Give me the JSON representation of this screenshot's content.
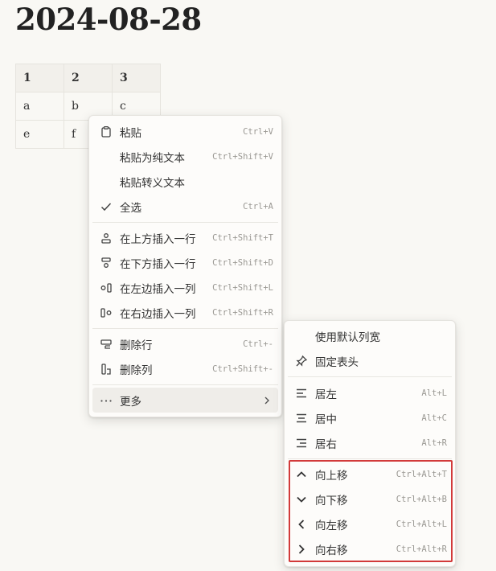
{
  "doc": {
    "title": "2024-08-28",
    "table": {
      "header": [
        "1",
        "2",
        "3"
      ],
      "rows": [
        [
          "a",
          "b",
          "c"
        ],
        [
          "e",
          "f",
          ""
        ]
      ]
    }
  },
  "context_menu": {
    "items": [
      {
        "label": "粘贴",
        "shortcut": "Ctrl+V",
        "icon": "clipboard-icon"
      },
      {
        "label": "粘贴为纯文本",
        "shortcut": "Ctrl+Shift+V"
      },
      {
        "label": "粘贴转义文本",
        "shortcut": ""
      },
      {
        "label": "全选",
        "shortcut": "Ctrl+A",
        "icon": "check-icon"
      },
      {
        "label": "在上方插入一行",
        "shortcut": "Ctrl+Shift+T",
        "icon": "insert-row-above-icon"
      },
      {
        "label": "在下方插入一行",
        "shortcut": "Ctrl+Shift+D",
        "icon": "insert-row-below-icon"
      },
      {
        "label": "在左边插入一列",
        "shortcut": "Ctrl+Shift+L",
        "icon": "insert-column-left-icon"
      },
      {
        "label": "在右边插入一列",
        "shortcut": "Ctrl+Shift+R",
        "icon": "insert-column-right-icon"
      },
      {
        "label": "删除行",
        "shortcut": "Ctrl+-",
        "icon": "delete-row-icon"
      },
      {
        "label": "删除列",
        "shortcut": "Ctrl+Shift+-",
        "icon": "delete-column-icon"
      },
      {
        "label": "更多",
        "shortcut": "",
        "icon": "more-dots-icon"
      }
    ]
  },
  "submenu": {
    "items": [
      {
        "label": "使用默认列宽",
        "shortcut": ""
      },
      {
        "label": "固定表头",
        "shortcut": "",
        "icon": "pin-icon"
      },
      {
        "label": "居左",
        "shortcut": "Alt+L",
        "icon": "align-left-icon"
      },
      {
        "label": "居中",
        "shortcut": "Alt+C",
        "icon": "align-center-icon"
      },
      {
        "label": "居右",
        "shortcut": "Alt+R",
        "icon": "align-right-icon"
      },
      {
        "label": "向上移",
        "shortcut": "Ctrl+Alt+T",
        "icon": "chevron-up-icon"
      },
      {
        "label": "向下移",
        "shortcut": "Ctrl+Alt+B",
        "icon": "chevron-down-icon"
      },
      {
        "label": "向左移",
        "shortcut": "Ctrl+Alt+L",
        "icon": "chevron-left-icon"
      },
      {
        "label": "向右移",
        "shortcut": "Ctrl+Alt+R",
        "icon": "chevron-right-icon"
      }
    ]
  },
  "colors": {
    "background": "#f9f8f4",
    "highlight_box": "#d23a3a"
  }
}
